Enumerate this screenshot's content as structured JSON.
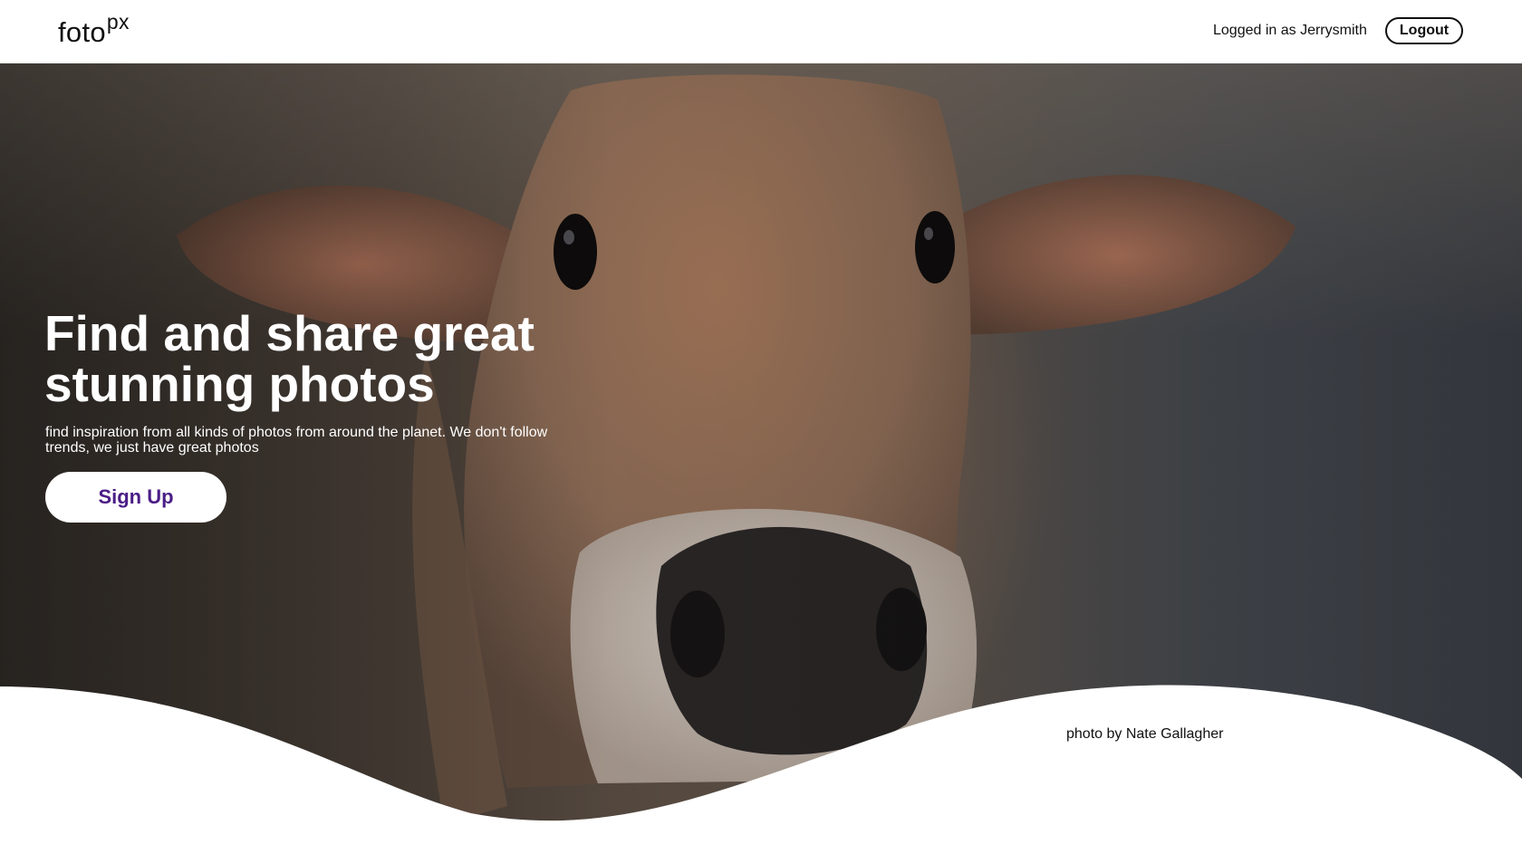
{
  "header": {
    "logo_text": "foto",
    "logo_sup": "px",
    "user_status": "Logged in as Jerrysmith",
    "logout_label": "Logout"
  },
  "hero": {
    "headline_line1": "Find and share great",
    "headline_line2": "stunning photos",
    "subtitle": "find inspiration from all kinds of photos from around the planet. We don't follow trends, we just have great photos",
    "signup_label": "Sign Up",
    "photo_credit": "photo by Nate Gallagher"
  },
  "colors": {
    "signup_text": "#4b1d86",
    "background": "#ffffff"
  }
}
